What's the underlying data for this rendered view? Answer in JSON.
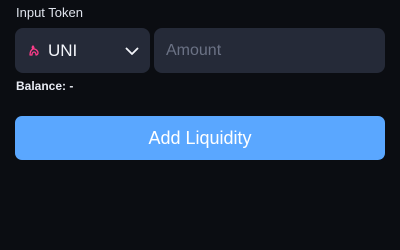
{
  "input_token": {
    "label": "Input Token",
    "selected_token": {
      "symbol": "UNI",
      "icon": "uniswap-unicorn-icon",
      "icon_color": "#ff3d8b"
    },
    "amount_placeholder": "Amount",
    "amount_value": ""
  },
  "balance": {
    "text": "Balance: -"
  },
  "actions": {
    "add_liquidity_label": "Add Liquidity"
  },
  "colors": {
    "background": "#0b0d12",
    "field_background": "#252a38",
    "accent": "#5aa7ff"
  }
}
